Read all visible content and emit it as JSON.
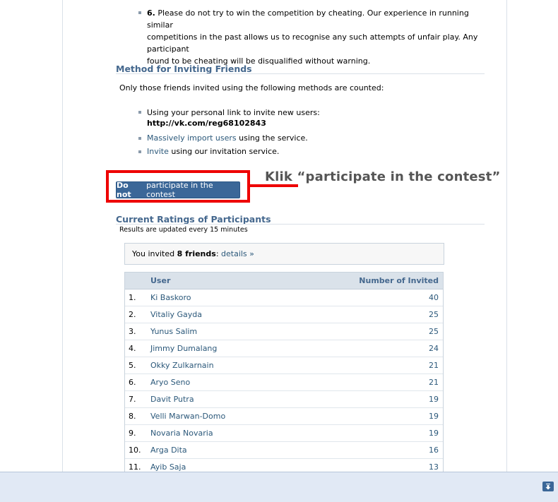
{
  "rules": {
    "item6_number": "6.",
    "item6_line1": "Please do not try to win the competition by cheating. Our experience in running similar",
    "item6_line2": "competitions in the past allows us to recognise any such attempts of unfair play. Any participant",
    "item6_line3": "found to be cheating will be disqualified without warning."
  },
  "methods": {
    "title": "Method for Inviting Friends",
    "intro": "Only those friends invited using the following methods are counted:",
    "item1_text": "Using your personal link to invite new users:",
    "item1_link": "http://vk.com/reg68102843",
    "item2_link": "Massively import users",
    "item2_text": " using the service.",
    "item3_link": "Invite",
    "item3_text": " using our invitation service."
  },
  "button": {
    "bold": "Do not",
    "rest": "participate in the contest"
  },
  "annotation": {
    "text": "Klik “participate in the contest”",
    "color": "#ee0000"
  },
  "ratings": {
    "title": "Current Ratings of Participants",
    "updated": "Results are updated every 15 minutes",
    "invited_prefix": "You invited ",
    "invited_count": "8 friends",
    "invited_colon": ": ",
    "details_link": "details »",
    "col_user": "User",
    "col_invited": "Number of Invited",
    "rows": [
      {
        "rank": "1.",
        "name": "Ki Baskoro",
        "count": "40"
      },
      {
        "rank": "2.",
        "name": "Vitaliy Gayda",
        "count": "25"
      },
      {
        "rank": "3.",
        "name": "Yunus Salim",
        "count": "25"
      },
      {
        "rank": "4.",
        "name": "Jimmy Dumalang",
        "count": "24"
      },
      {
        "rank": "5.",
        "name": "Okky Zulkarnain",
        "count": "21"
      },
      {
        "rank": "6.",
        "name": "Aryo Seno",
        "count": "21"
      },
      {
        "rank": "7.",
        "name": "Davit Putra",
        "count": "19"
      },
      {
        "rank": "8.",
        "name": "Velli Marwan-Domo",
        "count": "19"
      },
      {
        "rank": "9.",
        "name": "Novaria Novaria",
        "count": "19"
      },
      {
        "rank": "10.",
        "name": "Arga Dita",
        "count": "16"
      },
      {
        "rank": "11.",
        "name": "Ayib Saja",
        "count": "13"
      }
    ]
  },
  "bottom_bar": {
    "scroll_icon": "scroll-down-icon"
  }
}
